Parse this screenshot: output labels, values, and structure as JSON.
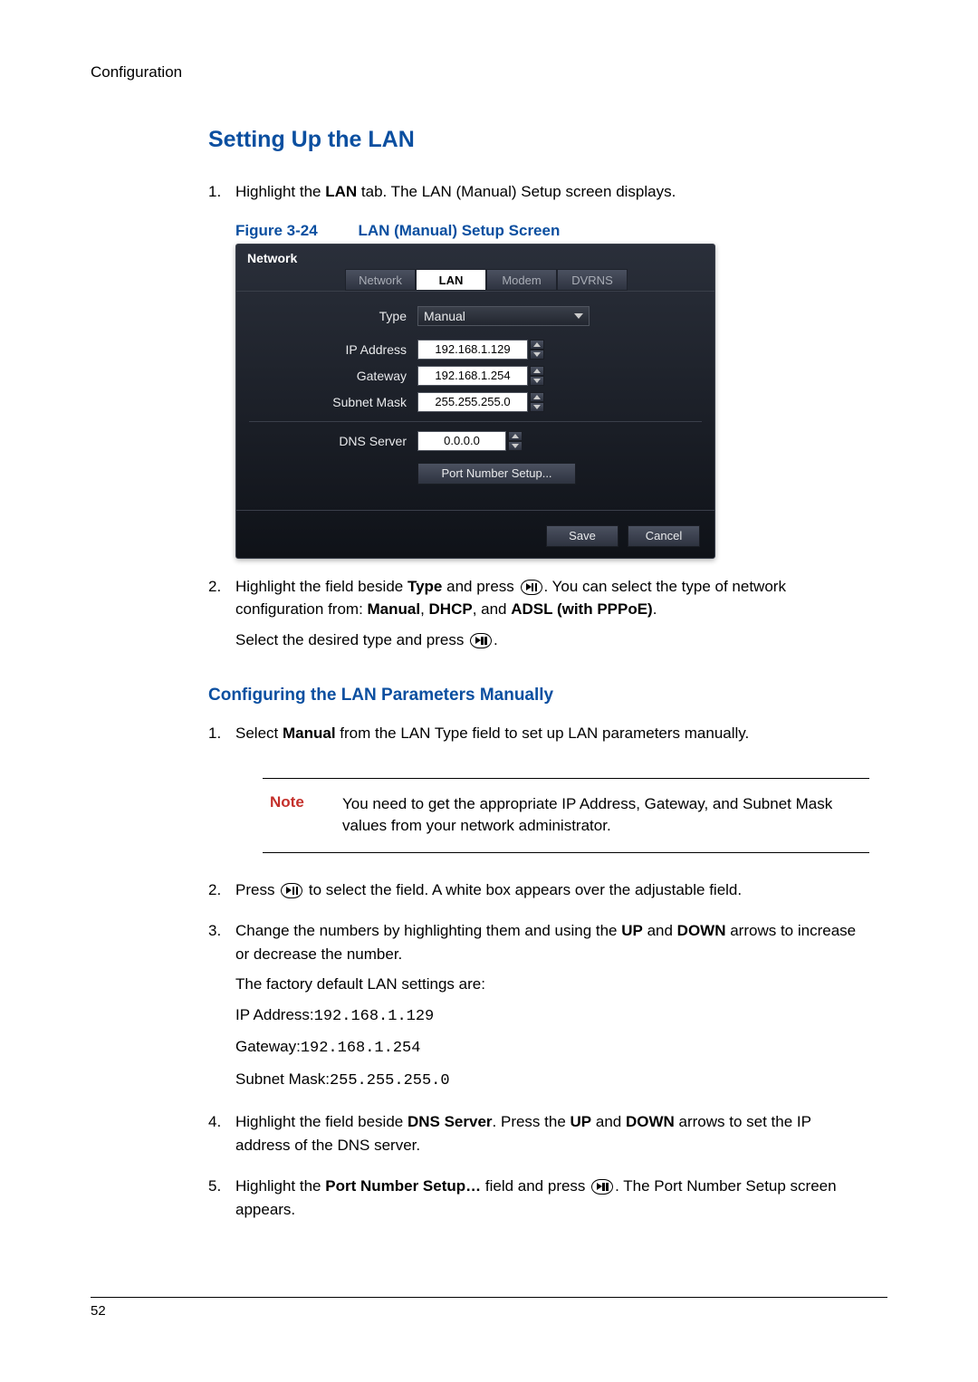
{
  "header": "Configuration",
  "section_title": "Setting Up the LAN",
  "steps_a": {
    "1": {
      "text_before": "Highlight the ",
      "bold1": "LAN",
      "text_after": " tab. The LAN (Manual) Setup screen displays."
    },
    "2": {
      "text1": "Highlight the field beside ",
      "bold_type": "Type",
      "text2": " and press ",
      "text3": ". You can select the type of network configuration from: ",
      "bold_manual": "Manual",
      "comma1": ", ",
      "bold_dhcp": "DHCP",
      "comma2": ", and ",
      "bold_adsl": "ADSL (with PPPoE)",
      "dot": ".",
      "line2a": "Select the desired type and press ",
      "line2b": "."
    }
  },
  "figure": {
    "num": "Figure 3-24",
    "title": "LAN (Manual) Setup Screen"
  },
  "screenshot": {
    "title": "Network",
    "tabs": [
      "Network",
      "LAN",
      "Modem",
      "DVRNS"
    ],
    "rows": {
      "type": "Type",
      "type_value": "Manual",
      "ip": "IP Address",
      "ip_value": "192.168.1.129",
      "gateway": "Gateway",
      "gateway_value": "192.168.1.254",
      "subnet": "Subnet Mask",
      "subnet_value": "255.255.255.0",
      "dns": "DNS Server",
      "dns_value": "0.0.0.0"
    },
    "port_btn": "Port Number Setup...",
    "save": "Save",
    "cancel": "Cancel"
  },
  "subsection_title": "Configuring the LAN Parameters Manually",
  "steps_b": {
    "1": {
      "a": "Select ",
      "bold": "Manual",
      "b": " from the LAN Type field to set up LAN parameters manually."
    },
    "2": {
      "a": "Press ",
      "b": " to select the field. A white box appears over the adjustable field."
    },
    "3": {
      "a": "Change the numbers by highlighting them and using the ",
      "up": "UP",
      "mid": " and ",
      "down": "DOWN",
      "b": " arrows to increase or decrease the number.",
      "factory": "The factory default LAN settings are:",
      "ip_label": "IP Address:",
      "ip_val": "192.168.1.129",
      "gw_label": "Gateway:",
      "gw_val": "192.168.1.254",
      "sm_label": "Subnet Mask:",
      "sm_val": "255.255.255.0"
    },
    "4": {
      "a": "Highlight the field beside ",
      "dns": "DNS Server",
      "b": ". Press the ",
      "up": "UP",
      "mid": " and ",
      "down": "DOWN",
      "c": " arrows to set the IP address of the DNS server."
    },
    "5": {
      "a": "Highlight the ",
      "port": "Port Number Setup…",
      "b": " field and press ",
      "c": ". The Port Number Setup screen appears."
    }
  },
  "note": {
    "label": "Note",
    "text": "You need to get the appropriate IP Address, Gateway, and Subnet Mask values from your network administrator."
  },
  "page_number": "52"
}
